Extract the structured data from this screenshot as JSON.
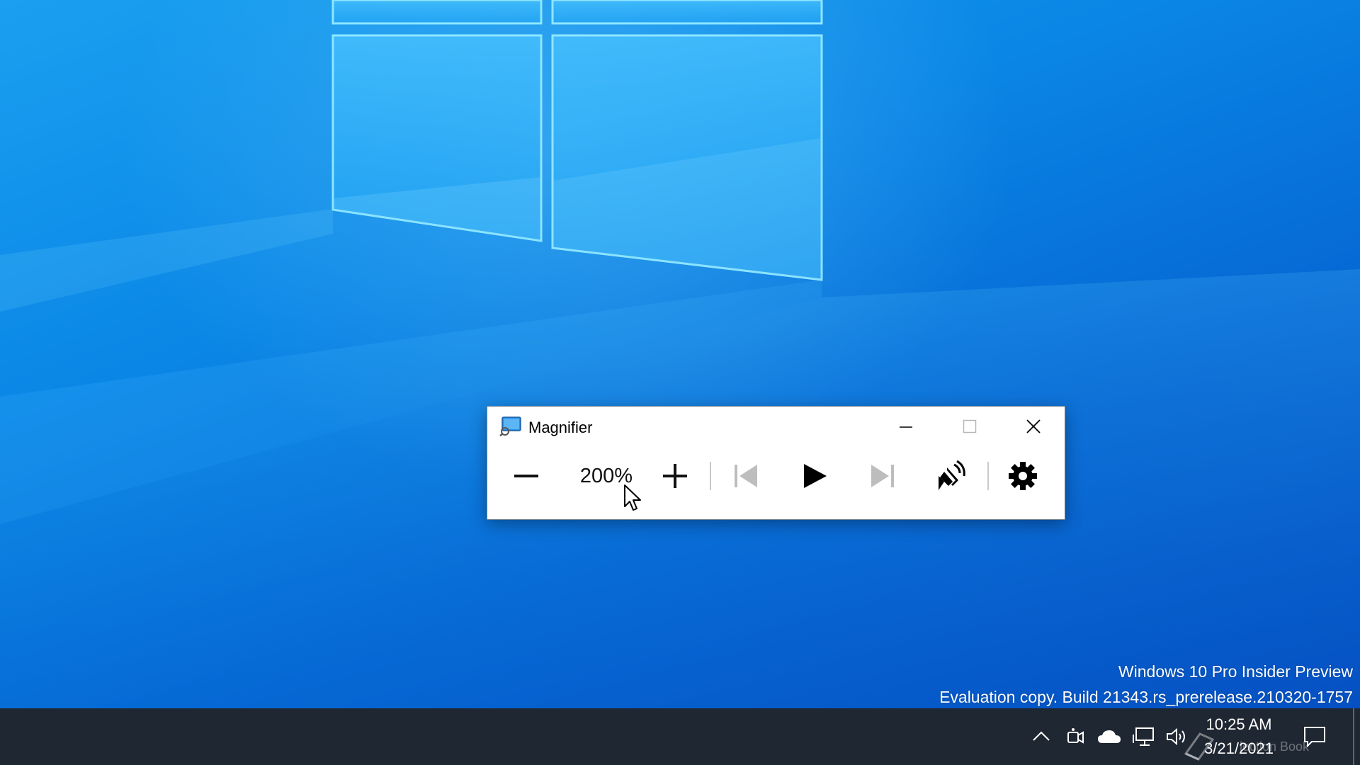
{
  "desktop": {
    "watermark": {
      "line1": "Windows 10 Pro Insider Preview",
      "line2": "Evaluation copy. Build 21343.rs_prerelease.210320-1757"
    }
  },
  "magnifier": {
    "title": "Magnifier",
    "zoom_level": "200%",
    "controls": {
      "zoom_out_icon": "minus-icon",
      "zoom_in_icon": "plus-icon",
      "previous_icon": "skip-back-icon",
      "play_icon": "play-icon",
      "next_icon": "skip-forward-icon",
      "read_from_here_icon": "read-aloud-icon",
      "settings_icon": "gear-icon"
    }
  },
  "taskbar": {
    "tray_icons": [
      "chevron-up-icon",
      "meet-now-icon",
      "onedrive-cloud-icon",
      "network-icon",
      "volume-icon"
    ],
    "clock": {
      "time": "10:25 AM",
      "date": "3/21/2021"
    },
    "overlay_text": "lection Book",
    "colors": {
      "taskbar_bg": "#1f2732",
      "desktop_accent": "#0a86e6"
    }
  }
}
